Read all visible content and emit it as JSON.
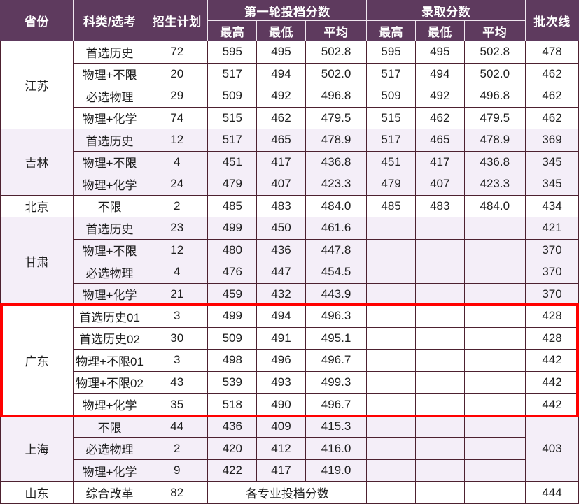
{
  "table": {
    "headers": {
      "province": "省份",
      "category": "科类/选考",
      "plan": "招生计划",
      "group_first_round": "第一轮投档分数",
      "group_admission": "录取分数",
      "batch_line": "批次线",
      "max": "最高",
      "min": "最低",
      "avg": "平均"
    },
    "colors": {
      "header_bg": "#5e3a5e",
      "header_text": "#ffffff",
      "grid": "#4d2130",
      "tint_row_bg": "#f4eef8",
      "plain_row_bg": "#ffffff",
      "highlight_border": "#ff0000"
    },
    "groups": [
      {
        "province": "江苏",
        "shade": "plain",
        "rows": [
          {
            "category": "首选历史",
            "plan": "72",
            "r1_max": "595",
            "r1_min": "495",
            "r1_avg": "502.8",
            "ad_max": "595",
            "ad_min": "495",
            "ad_avg": "502.8",
            "batch": "478"
          },
          {
            "category": "物理+不限",
            "plan": "20",
            "r1_max": "517",
            "r1_min": "494",
            "r1_avg": "502.0",
            "ad_max": "517",
            "ad_min": "494",
            "ad_avg": "502.0",
            "batch": "462"
          },
          {
            "category": "必选物理",
            "plan": "29",
            "r1_max": "509",
            "r1_min": "492",
            "r1_avg": "496.8",
            "ad_max": "509",
            "ad_min": "492",
            "ad_avg": "496.8",
            "batch": "462"
          },
          {
            "category": "物理+化学",
            "plan": "74",
            "r1_max": "515",
            "r1_min": "462",
            "r1_avg": "479.5",
            "ad_max": "515",
            "ad_min": "462",
            "ad_avg": "479.5",
            "batch": "462"
          }
        ]
      },
      {
        "province": "吉林",
        "shade": "tint",
        "rows": [
          {
            "category": "首选历史",
            "plan": "12",
            "r1_max": "517",
            "r1_min": "465",
            "r1_avg": "478.9",
            "ad_max": "517",
            "ad_min": "465",
            "ad_avg": "478.9",
            "batch": "369"
          },
          {
            "category": "物理+不限",
            "plan": "4",
            "r1_max": "451",
            "r1_min": "417",
            "r1_avg": "436.8",
            "ad_max": "451",
            "ad_min": "417",
            "ad_avg": "436.8",
            "batch": "345"
          },
          {
            "category": "物理+化学",
            "plan": "24",
            "r1_max": "479",
            "r1_min": "407",
            "r1_avg": "423.3",
            "ad_max": "479",
            "ad_min": "407",
            "ad_avg": "423.3",
            "batch": "345"
          }
        ]
      },
      {
        "province": "北京",
        "shade": "plain",
        "rows": [
          {
            "category": "不限",
            "plan": "2",
            "r1_max": "485",
            "r1_min": "483",
            "r1_avg": "484.0",
            "ad_max": "485",
            "ad_min": "483",
            "ad_avg": "484.0",
            "batch": "434"
          }
        ]
      },
      {
        "province": "甘肃",
        "shade": "tint",
        "rows": [
          {
            "category": "首选历史",
            "plan": "23",
            "r1_max": "499",
            "r1_min": "450",
            "r1_avg": "461.6",
            "ad_max": "",
            "ad_min": "",
            "ad_avg": "",
            "batch": "421"
          },
          {
            "category": "物理+不限",
            "plan": "12",
            "r1_max": "480",
            "r1_min": "436",
            "r1_avg": "447.8",
            "ad_max": "",
            "ad_min": "",
            "ad_avg": "",
            "batch": "370"
          },
          {
            "category": "必选物理",
            "plan": "4",
            "r1_max": "476",
            "r1_min": "447",
            "r1_avg": "454.5",
            "ad_max": "",
            "ad_min": "",
            "ad_avg": "",
            "batch": "370"
          },
          {
            "category": "物理+化学",
            "plan": "21",
            "r1_max": "459",
            "r1_min": "432",
            "r1_avg": "443.9",
            "ad_max": "",
            "ad_min": "",
            "ad_avg": "",
            "batch": "370"
          }
        ]
      },
      {
        "province": "广东",
        "shade": "plain",
        "highlighted": true,
        "rows": [
          {
            "category": "首选历史01",
            "plan": "3",
            "r1_max": "499",
            "r1_min": "494",
            "r1_avg": "496.3",
            "ad_max": "",
            "ad_min": "",
            "ad_avg": "",
            "batch": "428"
          },
          {
            "category": "首选历史02",
            "plan": "30",
            "r1_max": "509",
            "r1_min": "491",
            "r1_avg": "495.1",
            "ad_max": "",
            "ad_min": "",
            "ad_avg": "",
            "batch": "428"
          },
          {
            "category": "物理+不限01",
            "plan": "3",
            "r1_max": "498",
            "r1_min": "496",
            "r1_avg": "496.7",
            "ad_max": "",
            "ad_min": "",
            "ad_avg": "",
            "batch": "442"
          },
          {
            "category": "物理+不限02",
            "plan": "43",
            "r1_max": "539",
            "r1_min": "493",
            "r1_avg": "499.3",
            "ad_max": "",
            "ad_min": "",
            "ad_avg": "",
            "batch": "442"
          },
          {
            "category": "物理+化学",
            "plan": "35",
            "r1_max": "518",
            "r1_min": "490",
            "r1_avg": "496.7",
            "ad_max": "",
            "ad_min": "",
            "ad_avg": "",
            "batch": "442"
          }
        ]
      },
      {
        "province": "上海",
        "shade": "tint",
        "batch_merged": "403",
        "rows": [
          {
            "category": "不限",
            "plan": "44",
            "r1_max": "436",
            "r1_min": "409",
            "r1_avg": "415.3",
            "ad_max": "",
            "ad_min": "",
            "ad_avg": ""
          },
          {
            "category": "必选物理",
            "plan": "2",
            "r1_max": "420",
            "r1_min": "412",
            "r1_avg": "416.0",
            "ad_max": "",
            "ad_min": "",
            "ad_avg": ""
          },
          {
            "category": "物理+化学",
            "plan": "9",
            "r1_max": "422",
            "r1_min": "417",
            "r1_avg": "419.0",
            "ad_max": "",
            "ad_min": "",
            "ad_avg": ""
          }
        ]
      },
      {
        "province": "山东",
        "shade": "plain",
        "rows": [
          {
            "category": "综合改革",
            "plan": "82",
            "r1_span_text": "各专业投档分数",
            "ad_max": "",
            "ad_min": "",
            "ad_avg": "",
            "batch": "444"
          }
        ]
      }
    ]
  }
}
